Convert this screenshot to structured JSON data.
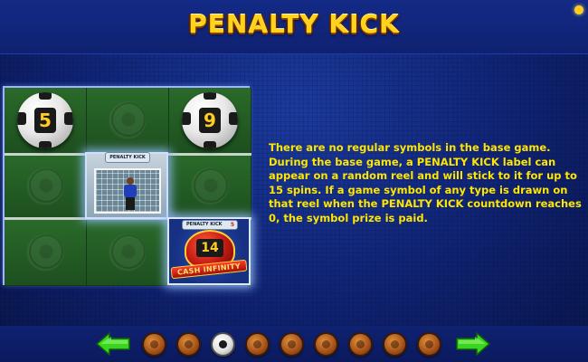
{
  "header": {
    "title": "PENALTY KICK"
  },
  "reel_grid": {
    "ball_numbers": [
      "5",
      "9"
    ],
    "penalty_tile": {
      "label": "PENALTY KICK"
    },
    "cash_tile": {
      "label": "PENALTY KICK",
      "countdown": "5",
      "value": "14",
      "banner": "CASH INFINITY"
    }
  },
  "description": "There are no regular symbols in the base game. During the base game, a PENALTY KICK label can appear on a random reel and will stick to it for up to 15 spins. If a game symbol of any type is drawn on that reel when the PENALTY KICK countdown reaches 0, the symbol prize is paid.",
  "pagination": {
    "total_pages": 9,
    "active_page": 3,
    "prev_icon": "left-arrow-icon",
    "next_icon": "right-arrow-icon"
  },
  "colors": {
    "title": "#ffd21c",
    "description_text": "#ffe600",
    "background": "#0b1a5e",
    "arrow": "#39d61f"
  }
}
